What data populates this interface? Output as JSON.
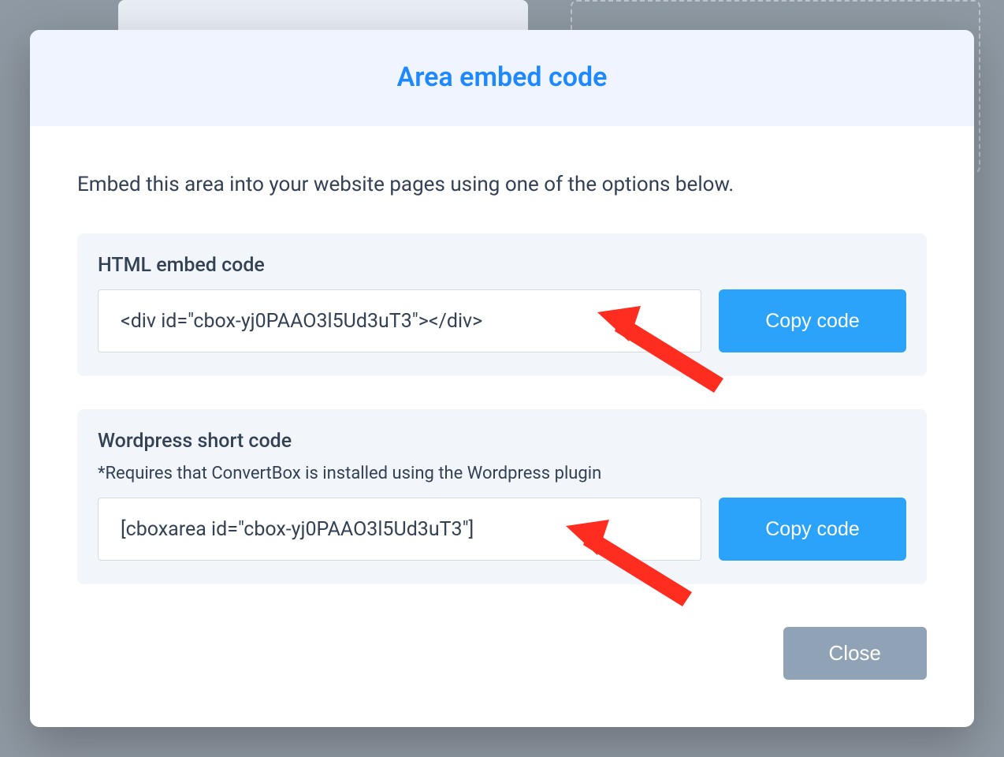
{
  "modal": {
    "title": "Area embed code",
    "intro": "Embed this area into your website pages using one of the options below.",
    "html_block": {
      "label": "HTML embed code",
      "code": "<div id=\"cbox-yj0PAAO3l5Ud3uT3\"></div>",
      "copy_label": "Copy code"
    },
    "wp_block": {
      "label": "Wordpress short code",
      "note": "*Requires that ConvertBox is installed using the Wordpress plugin",
      "code": "[cboxarea id=\"cbox-yj0PAAO3l5Ud3uT3\"]",
      "copy_label": "Copy code"
    },
    "close_label": "Close"
  },
  "colors": {
    "accent": "#1e88ff",
    "button": "#2ba3fa",
    "close": "#90a2b5",
    "panel": "#f2f6fb",
    "header_bg": "#eff4fe",
    "arrow": "#ff2d1f"
  }
}
